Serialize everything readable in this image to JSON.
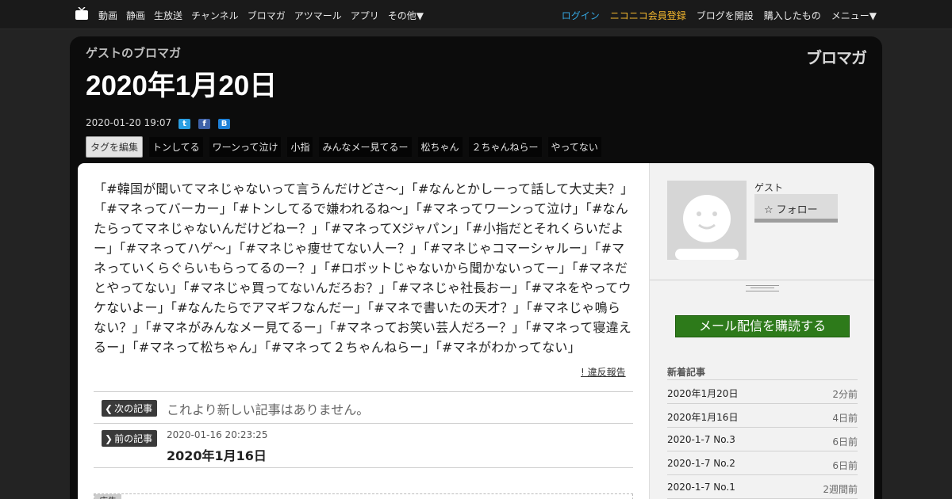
{
  "topnav": {
    "left": [
      "動画",
      "静画",
      "生放送",
      "チャンネル",
      "ブロマガ",
      "アツマール",
      "アプリ",
      "その他▼"
    ],
    "right": {
      "login": "ログイン",
      "register": "ニコニコ会員登録",
      "open_blog": "ブログを開設",
      "purchased": "購入したもの",
      "menu": "メニュー▼"
    }
  },
  "header": {
    "blog_name": "ゲストのブロマガ",
    "title": "2020年1月20日",
    "brand": "ブロマガ",
    "date": "2020-01-20 19:07",
    "tag_edit": "タグを編集",
    "tags": [
      "トンしてる",
      "ワーンって泣け",
      "小指",
      "みんなメー見てるー",
      "松ちゃん",
      "２ちゃんねらー",
      "やってない"
    ]
  },
  "article": {
    "body": "「#韓国が聞いてマネじゃないって言うんだけどさ〜」「#なんとかしーって話して大丈夫？」「#マネってバーカー」「#トンしてるで嫌われるね〜」「#マネってワーンって泣け」「#なんたらってマネじゃないんだけどねー？」「#マネってXジャパン」「#小指だとそれくらいだよー」「#マネってハゲ〜」「#マネじゃ痩せてない人ー？」「#マネじゃコマーシャルー」「#マネっていくらぐらいもらってるのー？」「#ロボットじゃないから聞かないってー」「#マネだとやってない」「#マネじゃ買ってないんだろお？」「#マネじゃ社長おー」「#マネをやってウケないよー」「#なんたらでアマギフなんだー」「#マネで書いたの天才？」「#マネじゃ鳴らない？」「#マネがみんなメー見てるー」「#マネってお笑い芸人だろー？」「#マネって寝違えるー」「#マネって松ちゃん」「#マネって２ちゃんねらー」「#マネがわかってない」",
    "report": "! 違反報告",
    "next_label": "次の記事",
    "no_newer": "これより新しい記事はありません。",
    "prev_label": "前の記事",
    "prev_date": "2020-01-16 20:23:25",
    "prev_title": "2020年1月16日",
    "ad_label": "広告"
  },
  "sidebar": {
    "user": "ゲスト",
    "follow": "フォロー",
    "subscribe": "メール配信を購読する",
    "new_heading": "新着記事",
    "new_articles": [
      {
        "title": "2020年1月20日",
        "ago": "2分前"
      },
      {
        "title": "2020年1月16日",
        "ago": "4日前"
      },
      {
        "title": "2020-1-7 No.3",
        "ago": "6日前"
      },
      {
        "title": "2020-1-7 No.2",
        "ago": "6日前"
      },
      {
        "title": "2020-1-7 No.1",
        "ago": "2週間前"
      }
    ]
  },
  "colors": {
    "accent_login": "#35a7e2",
    "accent_register": "#f7b92e",
    "subscribe": "#2d7a1a"
  }
}
